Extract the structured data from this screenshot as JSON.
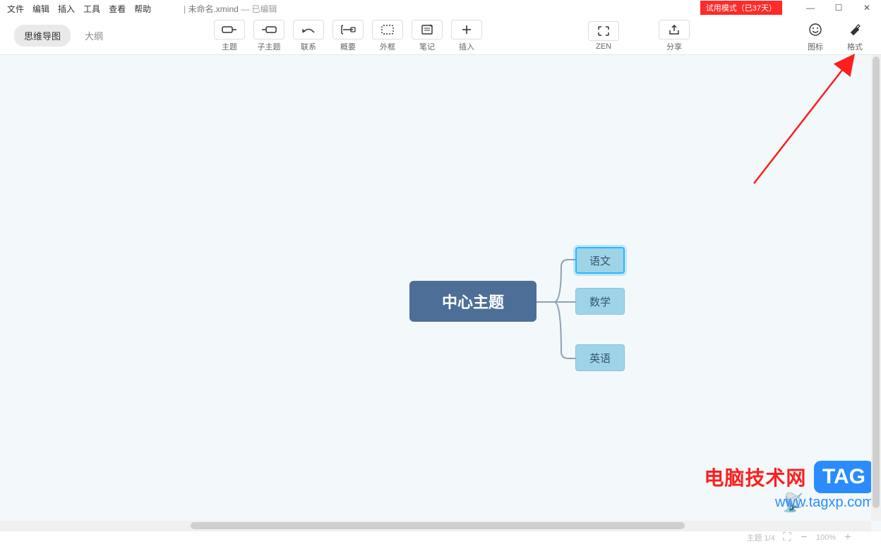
{
  "menu": [
    "文件",
    "编辑",
    "插入",
    "工具",
    "查看",
    "帮助"
  ],
  "doc": {
    "filename": "未命名.xmind",
    "status": "— 已编辑"
  },
  "trial_badge": "试用模式（已37天）",
  "win": {
    "min": "—",
    "max": "☐",
    "close": "✕"
  },
  "view_tabs": {
    "mindmap": "思维导图",
    "outline": "大纲"
  },
  "tools": {
    "topic": "主题",
    "subtopic": "子主题",
    "relationship": "联系",
    "summary": "概要",
    "boundary": "外框",
    "note": "笔记",
    "insert": "插入",
    "zen": "ZEN",
    "share": "分享",
    "icon": "图标",
    "format": "格式"
  },
  "mindmap": {
    "central": "中心主题",
    "nodes": [
      "语文",
      "数学",
      "英语"
    ]
  },
  "watermark": {
    "brand": "电脑技术网",
    "tag": "TAG",
    "url": "www.tagxp.com"
  },
  "status": {
    "count": "主题 1/4",
    "zoom": "100%"
  }
}
